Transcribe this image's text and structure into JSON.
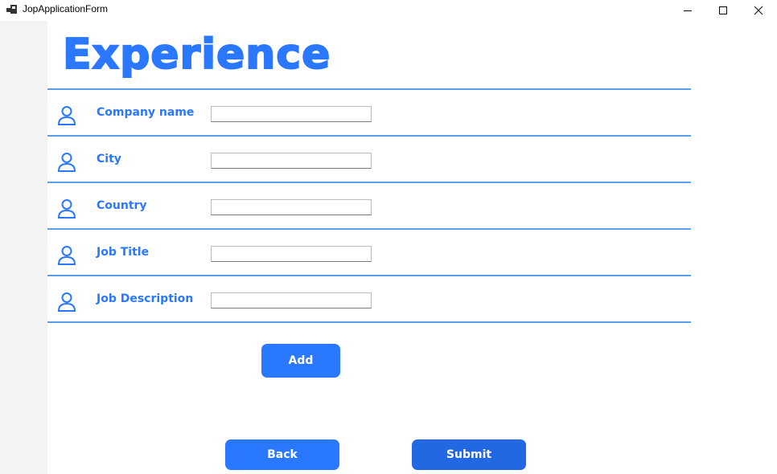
{
  "window": {
    "title": "JopApplicationForm",
    "controls": [
      "minimize-icon",
      "maximize-icon",
      "close-icon"
    ]
  },
  "page": {
    "heading": "Experience"
  },
  "form": {
    "fields": [
      {
        "label": "Company name",
        "value": "",
        "icon": "user-icon"
      },
      {
        "label": "City",
        "value": "",
        "icon": "user-icon"
      },
      {
        "label": "Country",
        "value": "",
        "icon": "user-icon"
      },
      {
        "label": "Job Title",
        "value": "",
        "icon": "user-icon"
      },
      {
        "label": "Job Description",
        "value": "",
        "icon": "user-icon"
      }
    ]
  },
  "buttons": {
    "add": "Add",
    "back": "Back",
    "submit": "Submit"
  },
  "colors": {
    "accent": "#2a78ff",
    "divider": "#5aa0f2",
    "submit": "#2268e3",
    "sidebar": "#f3f3f3"
  }
}
